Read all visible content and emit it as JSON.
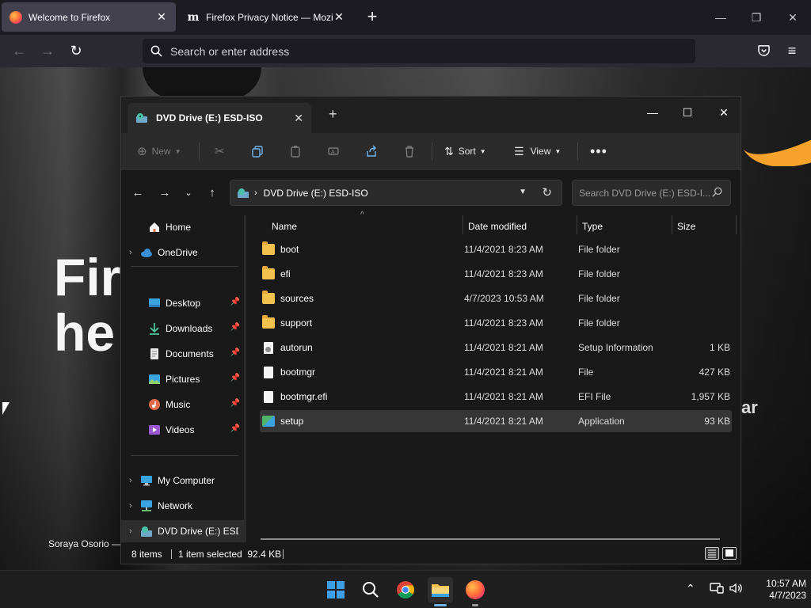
{
  "firefox": {
    "tabs": [
      {
        "title": "Welcome to Firefox",
        "active": true
      },
      {
        "title": "Firefox Privacy Notice — Mozill",
        "active": false
      }
    ],
    "urlbar_placeholder": "Search or enter address"
  },
  "webpage": {
    "hero_line1": "Fir",
    "hero_line2": "he",
    "right_fragment": "ar",
    "credit": "Soraya Osorio —"
  },
  "explorer": {
    "tab_title": "DVD Drive (E:) ESD-ISO",
    "toolbar": {
      "new_label": "New",
      "sort_label": "Sort",
      "view_label": "View"
    },
    "breadcrumb": "DVD Drive (E:) ESD-ISO",
    "search_placeholder": "Search DVD Drive (E:) ESD-I...",
    "nav": {
      "home": "Home",
      "onedrive": "OneDrive",
      "quick": [
        "Desktop",
        "Downloads",
        "Documents",
        "Pictures",
        "Music",
        "Videos"
      ],
      "my_computer": "My Computer",
      "network": "Network",
      "dvd": "DVD Drive (E:) ESD-"
    },
    "columns": {
      "name": "Name",
      "date": "Date modified",
      "type": "Type",
      "size": "Size"
    },
    "files": [
      {
        "name": "boot",
        "date": "11/4/2021 8:23 AM",
        "type": "File folder",
        "size": "",
        "icon": "folder"
      },
      {
        "name": "efi",
        "date": "11/4/2021 8:23 AM",
        "type": "File folder",
        "size": "",
        "icon": "folder"
      },
      {
        "name": "sources",
        "date": "4/7/2023 10:53 AM",
        "type": "File folder",
        "size": "",
        "icon": "folder"
      },
      {
        "name": "support",
        "date": "11/4/2021 8:23 AM",
        "type": "File folder",
        "size": "",
        "icon": "folder"
      },
      {
        "name": "autorun",
        "date": "11/4/2021 8:21 AM",
        "type": "Setup Information",
        "size": "1 KB",
        "icon": "setup-info"
      },
      {
        "name": "bootmgr",
        "date": "11/4/2021 8:21 AM",
        "type": "File",
        "size": "427 KB",
        "icon": "file"
      },
      {
        "name": "bootmgr.efi",
        "date": "11/4/2021 8:21 AM",
        "type": "EFI File",
        "size": "1,957 KB",
        "icon": "file"
      },
      {
        "name": "setup",
        "date": "11/4/2021 8:21 AM",
        "type": "Application",
        "size": "93 KB",
        "icon": "application",
        "selected": true
      }
    ],
    "status": {
      "count": "8 items",
      "selection": "1 item selected  92.4 KB"
    }
  },
  "taskbar": {
    "time": "10:57 AM",
    "date": "4/7/2023"
  },
  "colors": {
    "firefox_bg": "#1c1b22",
    "explorer_bg": "#191919",
    "accent_blue": "#3fa0ea",
    "folder": "#f2c14e"
  }
}
